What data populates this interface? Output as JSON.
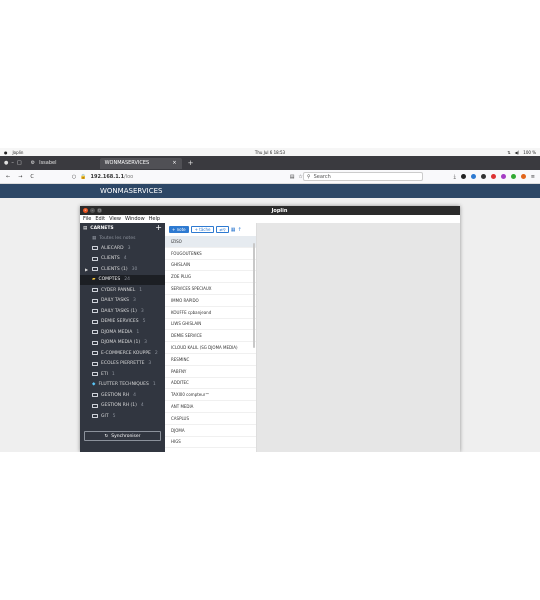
{
  "topbar": {
    "activities": "Joplin",
    "clock": "Thu Jul 6  18:53",
    "battery": "100 %"
  },
  "tabs": [
    {
      "label": "Issabel",
      "active": false
    },
    {
      "label": "WONMASERVICES",
      "active": true
    }
  ],
  "new_tab": "+",
  "url": {
    "host": "192.168.1.1",
    "path": "/loo",
    "lock": "🔒"
  },
  "search_placeholder": "Search",
  "web_header": "WONMASERVICES",
  "joplin": {
    "title": "Joplin",
    "menu": [
      "File",
      "Edit",
      "View",
      "Window",
      "Help"
    ],
    "sidebar_title": "CARNETS",
    "all_notes": "Toutes les notes",
    "notebooks": [
      {
        "label": "ALIECARD",
        "count": "3"
      },
      {
        "label": "CLIENTS",
        "count": "4"
      },
      {
        "label": "CLIENTS (1)",
        "count": "30"
      },
      {
        "label": "COMPTES",
        "count": "24"
      },
      {
        "label": "CYDER PANNEL",
        "count": "1"
      },
      {
        "label": "DAILY TASKS",
        "count": "3"
      },
      {
        "label": "DAILY TASKS (1)",
        "count": "3"
      },
      {
        "label": "DEMIE SERVICES",
        "count": "5"
      },
      {
        "label": "DJOMA MEDIA",
        "count": "1"
      },
      {
        "label": "DJOMA MEDIA (1)",
        "count": "3"
      },
      {
        "label": "E-COMMERCE KOUPPE",
        "count": "2"
      },
      {
        "label": "ECOLES PIERRETTE",
        "count": "3"
      },
      {
        "label": "ETI",
        "count": "1"
      },
      {
        "label": "FLUTTER TECHNIQUES",
        "count": "1"
      },
      {
        "label": "GESTION RH",
        "count": "4"
      },
      {
        "label": "GESTION RH (1)",
        "count": "4"
      },
      {
        "label": "GIT",
        "count": "5"
      }
    ],
    "sync_label": "Synchroniser",
    "btn_note": "+ note",
    "btn_todo": "+ tâche",
    "notes": [
      "IZISO",
      "FOUGOUTENKS",
      "GHISLAIN",
      "ZOE PLUG",
      "SERVICES SPECIAUX",
      "IMMO RAPIDO",
      "KOUFFE cpbanjeand",
      "LIWS GHISLAIN",
      "DEMIE SERVICE",
      "ICLOUD KALIL (SG DJOMA MEDIA)",
      "RESMINC",
      "PABFNY",
      "ADDITEC",
      "TAXI00 compteur™",
      "ANT MEDIA",
      "CASPLUS",
      "DJOMA",
      "HIGS"
    ]
  }
}
